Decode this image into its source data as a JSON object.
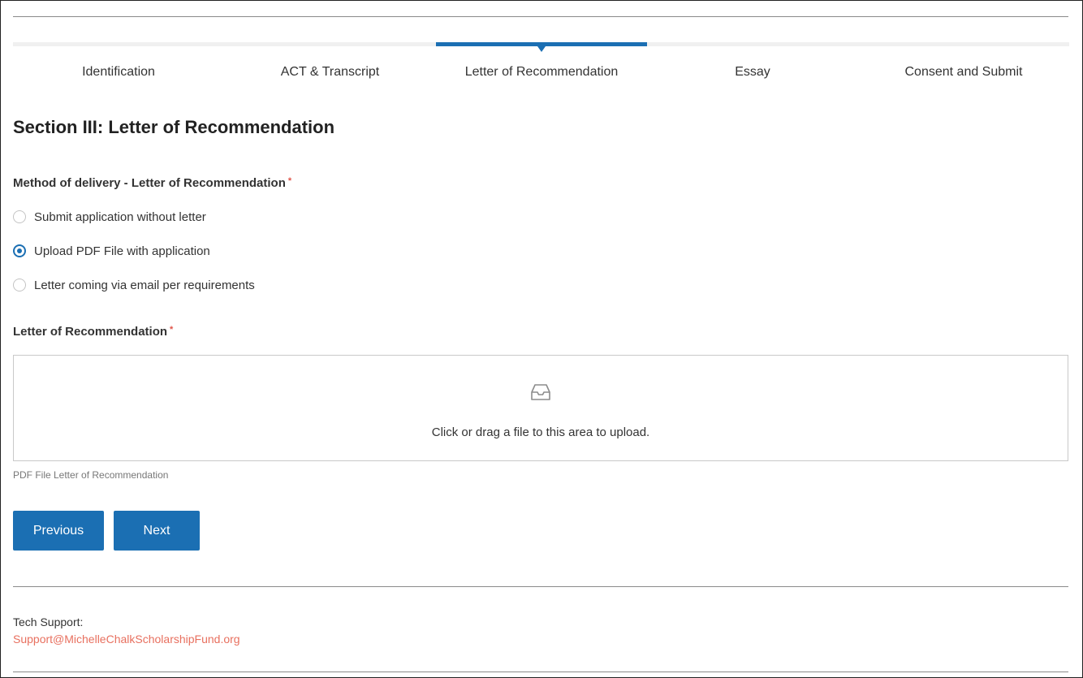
{
  "tabs": [
    {
      "label": "Identification",
      "active": false
    },
    {
      "label": "ACT & Transcript",
      "active": false
    },
    {
      "label": "Letter of Recommendation",
      "active": true
    },
    {
      "label": "Essay",
      "active": false
    },
    {
      "label": "Consent and Submit",
      "active": false
    }
  ],
  "section": {
    "title": "Section III: Letter of Recommendation"
  },
  "delivery": {
    "label": "Method of delivery - Letter of Recommendation",
    "required_mark": "*",
    "options": [
      {
        "label": "Submit application without letter",
        "checked": false
      },
      {
        "label": "Upload PDF File with application",
        "checked": true
      },
      {
        "label": "Letter coming via email per requirements",
        "checked": false
      }
    ]
  },
  "upload": {
    "label": "Letter of Recommendation",
    "required_mark": "*",
    "icon": "inbox-icon",
    "prompt": "Click or drag a file to this area to upload.",
    "help": "PDF File Letter of Recommendation"
  },
  "buttons": {
    "previous": "Previous",
    "next": "Next"
  },
  "footer": {
    "support_label": "Tech Support:",
    "support_email": "Support@MichelleChalkScholarshipFund.org"
  },
  "colors": {
    "accent": "#1b6fb3",
    "required": "#e0554a",
    "link": "#e8705f"
  }
}
